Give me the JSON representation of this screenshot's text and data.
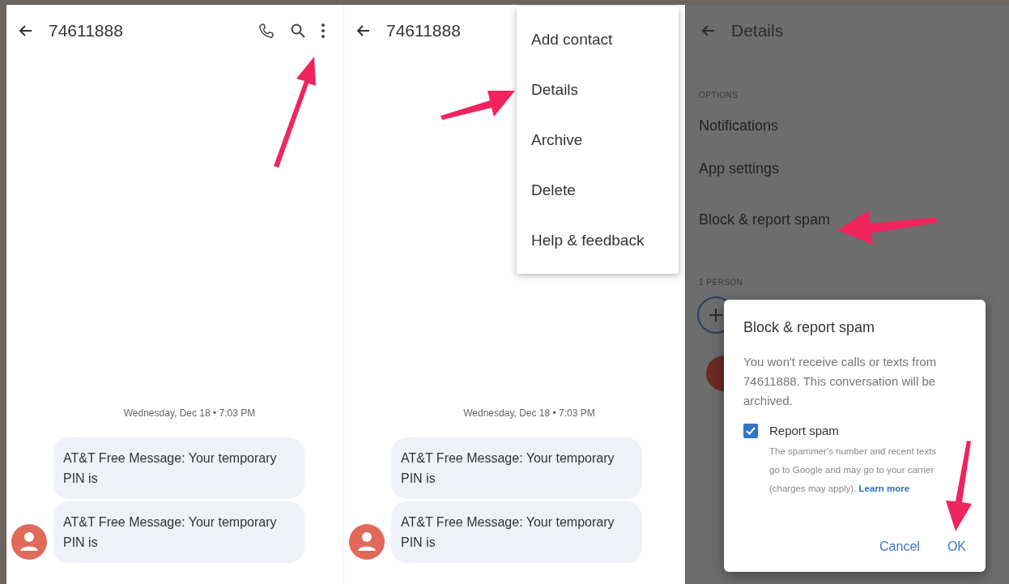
{
  "screens": [
    {
      "kind": "conversation",
      "title": "74611888",
      "date": "Wednesday, Dec 18 • 7:03 PM",
      "messages": [
        "AT&T Free Message: Your temporary PIN is",
        "AT&T Free Message: Your temporary PIN is"
      ]
    },
    {
      "kind": "conversation",
      "title": "74611888",
      "date": "Wednesday, Dec 18 • 7:03 PM",
      "messages": [
        "AT&T Free Message: Your temporary PIN is",
        "AT&T Free Message: Your temporary PIN is"
      ],
      "menu": [
        "Add contact",
        "Details",
        "Archive",
        "Delete",
        "Help & feedback"
      ]
    },
    {
      "kind": "details",
      "title": "Details",
      "section_options": "OPTIONS",
      "options": [
        "Notifications",
        "App settings",
        "Block & report spam"
      ],
      "section_people": "1 PERSON",
      "dialog": {
        "title": "Block & report spam",
        "body": "You won't receive calls or texts from 74611888. This conversation will be archived.",
        "checkbox": {
          "label": "Report spam",
          "checked": true,
          "description": "The spammer's number and recent texts go to Google and may go to your carrier (charges may apply).",
          "link": "Learn more"
        },
        "buttons": [
          "Cancel",
          "OK"
        ]
      }
    }
  ]
}
